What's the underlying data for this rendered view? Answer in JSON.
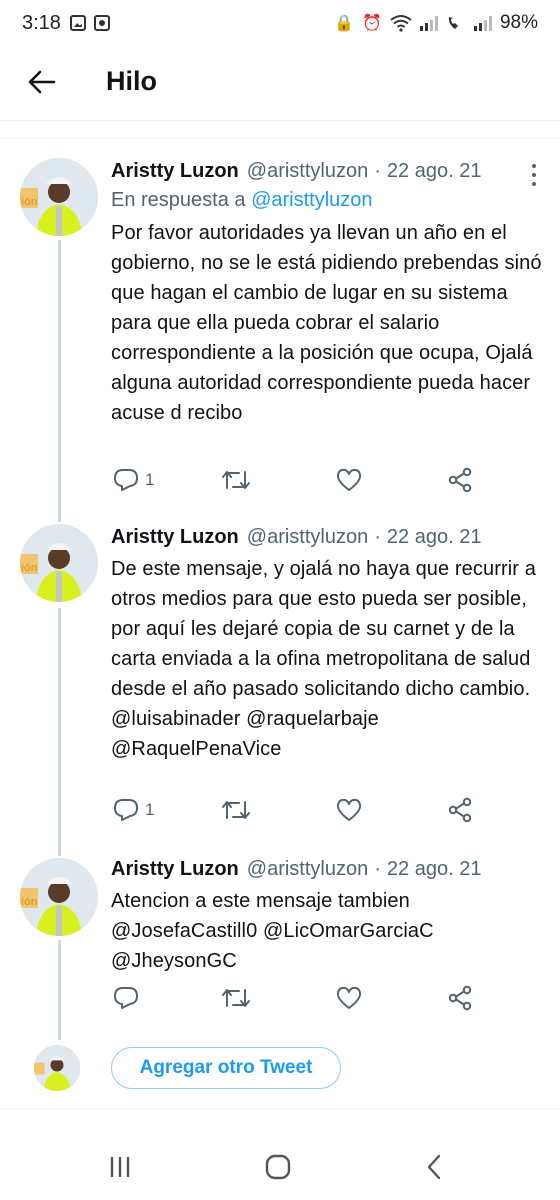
{
  "status_bar": {
    "time": "3:18",
    "battery": "98%"
  },
  "header": {
    "title": "Hilo"
  },
  "tweets": [
    {
      "name": "Aristty Luzon",
      "handle": "@aristtyluzon",
      "separator": "·",
      "date": "22 ago. 21",
      "reply_prefix": "En respuesta a",
      "reply_handle": "@aristtyluzon",
      "text": "Por favor autoridades ya llevan un año en el gobierno, no se le está pidiendo prebendas sinó que hagan el cambio de lugar en su sistema para que ella pueda cobrar el salario correspondiente a la posición que ocupa, Ojalá alguna autoridad correspondiente pueda hacer acuse d recibo",
      "mentions": "",
      "reply_count": "1"
    },
    {
      "name": "Aristty Luzon",
      "handle": "@aristtyluzon",
      "separator": "·",
      "date": "22 ago. 21",
      "text": "De este mensaje, y ojalá no haya que recurrir a otros medios para que esto pueda ser posible, por aquí les dejaré copia de su carnet y de la carta enviada a la ofina metropolitana de salud desde el año pasado solicitando dicho cambio.",
      "mentions": "@luisabinader @raquelarbaje @RaquelPenaVice",
      "reply_count": "1"
    },
    {
      "name": "Aristty Luzon",
      "handle": "@aristtyluzon",
      "separator": "·",
      "date": "22 ago. 21",
      "text": "Atencion a este mensaje tambien",
      "mentions": "@JosefaCastill0 @LicOmarGarciaC @JheysonGC",
      "reply_count": ""
    }
  ],
  "compose": {
    "add_tweet_label": "Agregar otro Tweet"
  },
  "icons": [
    "back-arrow-icon",
    "reply-icon",
    "retweet-icon",
    "like-icon",
    "share-icon",
    "more-icon",
    "recents-icon",
    "home-icon",
    "back-icon"
  ],
  "colors": {
    "accent": "#1d9bf0",
    "text": "#0f1419",
    "secondary": "#536471",
    "thread_line": "#cfd9de"
  }
}
